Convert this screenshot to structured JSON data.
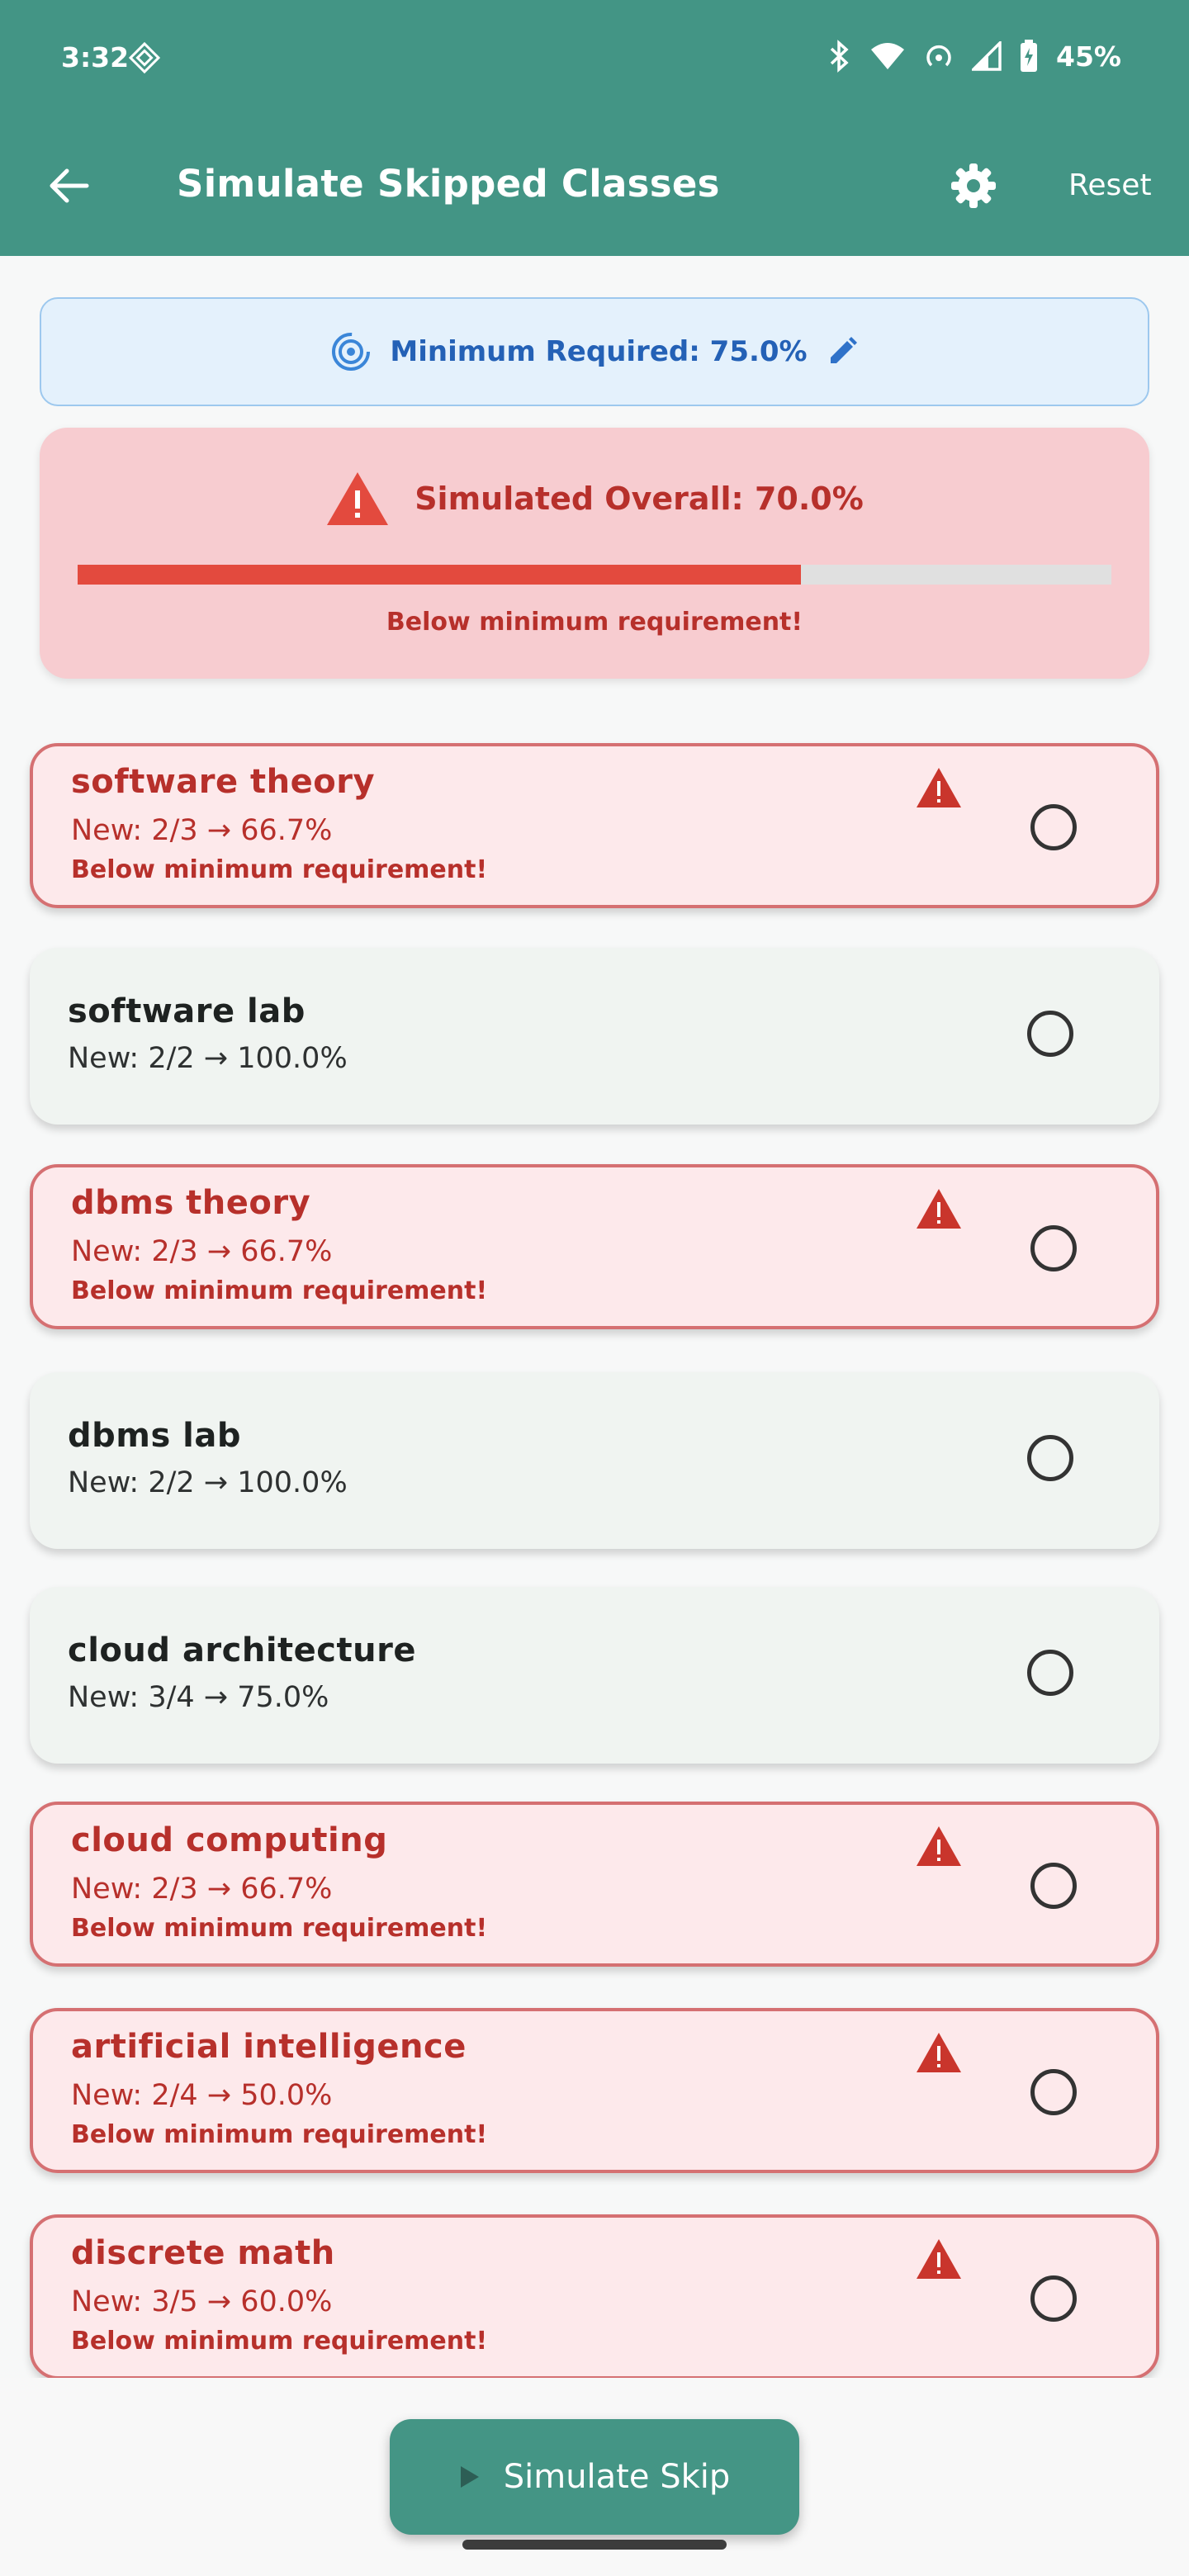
{
  "status_bar": {
    "time": "3:32",
    "battery": "45%",
    "icons": [
      "nfc-icon",
      "bluetooth-icon",
      "wifi-icon",
      "hotspot-icon",
      "signal-icon",
      "battery-icon"
    ]
  },
  "appbar": {
    "title": "Simulate Skipped Classes",
    "reset_label": "Reset",
    "background": "#439585",
    "icons": [
      "back-arrow-icon",
      "gear-icon"
    ]
  },
  "minimum": {
    "label": "Minimum Required: 75.0%",
    "icons": [
      "target-icon",
      "pencil-icon"
    ],
    "color": "#2461b6"
  },
  "simulated": {
    "title": "Simulated Overall: 70.0%",
    "progress_fraction": 0.7,
    "subtitle": "Below minimum requirement!",
    "color": "#e34a3e"
  },
  "courses": [
    {
      "name": "software theory",
      "new": "New: 2/3 → 66.7%",
      "warning": "Below minimum requirement!",
      "below": true
    },
    {
      "name": "software lab",
      "new": "New: 2/2 → 100.0%",
      "warning": "",
      "below": false
    },
    {
      "name": "dbms theory",
      "new": "New: 2/3 → 66.7%",
      "warning": "Below minimum requirement!",
      "below": true
    },
    {
      "name": "dbms lab",
      "new": "New: 2/2 → 100.0%",
      "warning": "",
      "below": false
    },
    {
      "name": "cloud architecture",
      "new": "New: 3/4 → 75.0%",
      "warning": "",
      "below": false
    },
    {
      "name": "cloud computing",
      "new": "New: 2/3 → 66.7%",
      "warning": "Below minimum requirement!",
      "below": true
    },
    {
      "name": "artificial intelligence",
      "new": "New: 2/4 → 50.0%",
      "warning": "Below minimum requirement!",
      "below": true
    },
    {
      "name": "discrete math",
      "new": "New: 3/5 → 60.0%",
      "warning": "Below minimum requirement!",
      "below": true
    }
  ],
  "simulate_button": {
    "label": "Simulate Skip",
    "icon": "play-icon"
  }
}
